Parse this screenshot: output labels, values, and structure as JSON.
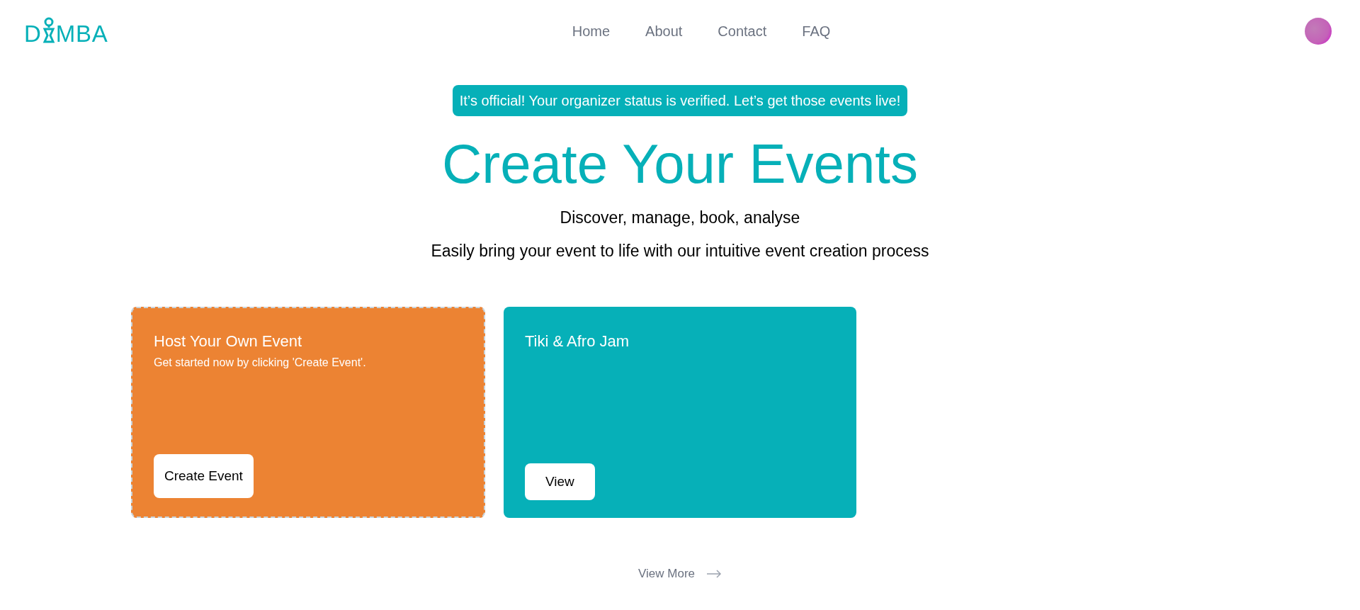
{
  "logo": {
    "before_pin": "D",
    "after_pin": "MBA"
  },
  "nav": [
    {
      "label": "Home"
    },
    {
      "label": "About"
    },
    {
      "label": "Contact"
    },
    {
      "label": "FAQ"
    }
  ],
  "banner": "It’s official! Your organizer status is verified. Let’s get those events live!",
  "title": "Create Your Events",
  "subtitle": "Discover, manage, book, analyse",
  "tagline": "Easily bring your event to life with our intuitive event creation process",
  "cards": [
    {
      "kind": "create",
      "title": "Host Your Own Event",
      "text": "Get started now by clicking 'Create Event'.",
      "button": "Create Event"
    },
    {
      "kind": "event",
      "title": "Tiki & Afro Jam",
      "button": "View"
    }
  ],
  "view_more": "View More"
}
